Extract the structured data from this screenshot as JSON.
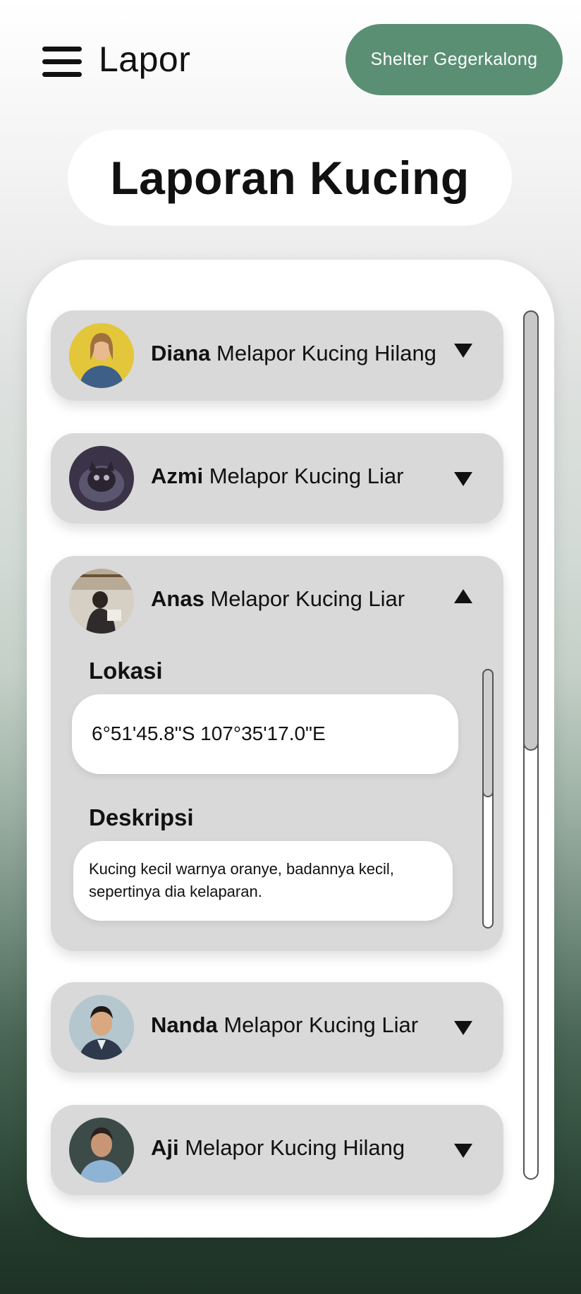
{
  "header": {
    "title": "Lapor",
    "shelter_button": "Shelter Gegerkalong"
  },
  "page_title": "Laporan Kucing",
  "reports": [
    {
      "name": "Diana",
      "action": " Melapor Kucing Hilang",
      "expanded": false
    },
    {
      "name": "Azmi",
      "action": " Melapor Kucing Liar",
      "expanded": false
    },
    {
      "name": "Anas",
      "action": " Melapor Kucing Liar",
      "expanded": true,
      "location_label": "Lokasi",
      "location_value": "6°51'45.8\"S 107°35'17.0\"E",
      "description_label": "Deskripsi",
      "description_value": "Kucing kecil warnya oranye, badannya kecil, sepertinya dia kelaparan."
    },
    {
      "name": "Nanda",
      "action": " Melapor Kucing Liar",
      "expanded": false
    },
    {
      "name": "Aji",
      "action": " Melapor Kucing Hilang",
      "expanded": false
    }
  ],
  "colors": {
    "accent": "#5a8f74",
    "card": "#d9d9d9"
  },
  "icons": {
    "menu": "hamburger-menu-icon",
    "collapsed": "triangle-down-icon",
    "expanded": "triangle-up-icon"
  }
}
